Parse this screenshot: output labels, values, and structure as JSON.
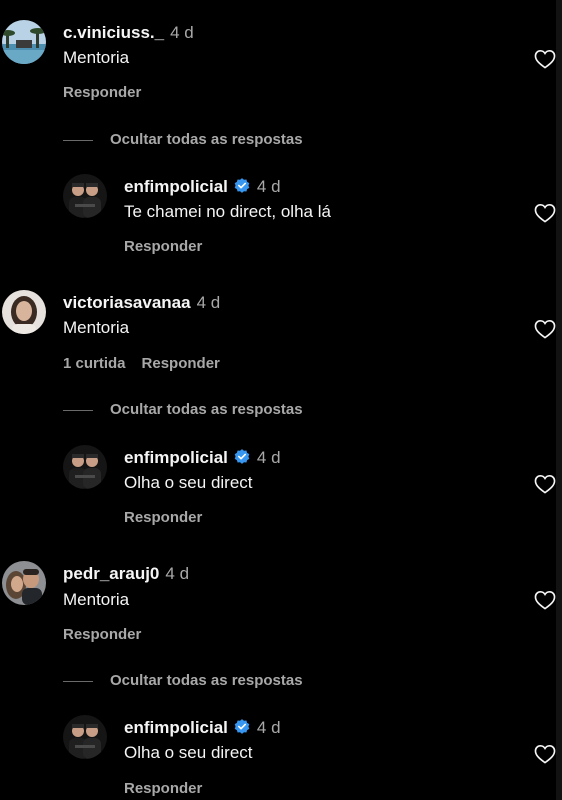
{
  "colors": {
    "background": "#000000",
    "text": "#f5f5f5",
    "secondary": "#a8a8a8",
    "verified": "#3797f0"
  },
  "threads": [
    {
      "comment": {
        "username": "c.viniciuss._",
        "time": "4 d",
        "text": "Mentoria",
        "likes": "",
        "reply_label": "Responder",
        "avatar": "beach-avatar"
      },
      "hide_replies_label": "Ocultar todas as respostas",
      "reply": {
        "username": "enfimpolicial",
        "verified": true,
        "time": "4 d",
        "text": "Te chamei no direct, olha lá",
        "reply_label": "Responder",
        "avatar": "two-men-avatar"
      }
    },
    {
      "comment": {
        "username": "victoriasavanaa",
        "time": "4 d",
        "text": "Mentoria",
        "likes": "1 curtida",
        "reply_label": "Responder",
        "avatar": "woman-avatar"
      },
      "hide_replies_label": "Ocultar todas as respostas",
      "reply": {
        "username": "enfimpolicial",
        "verified": true,
        "time": "4 d",
        "text": "Olha o seu direct",
        "reply_label": "Responder",
        "avatar": "two-men-avatar"
      }
    },
    {
      "comment": {
        "username": "pedr_arauj0",
        "time": "4 d",
        "text": "Mentoria",
        "likes": "",
        "reply_label": "Responder",
        "avatar": "couple-avatar"
      },
      "hide_replies_label": "Ocultar todas as respostas",
      "reply": {
        "username": "enfimpolicial",
        "verified": true,
        "time": "4 d",
        "text": "Olha o seu direct",
        "reply_label": "Responder",
        "avatar": "two-men-avatar"
      }
    }
  ]
}
